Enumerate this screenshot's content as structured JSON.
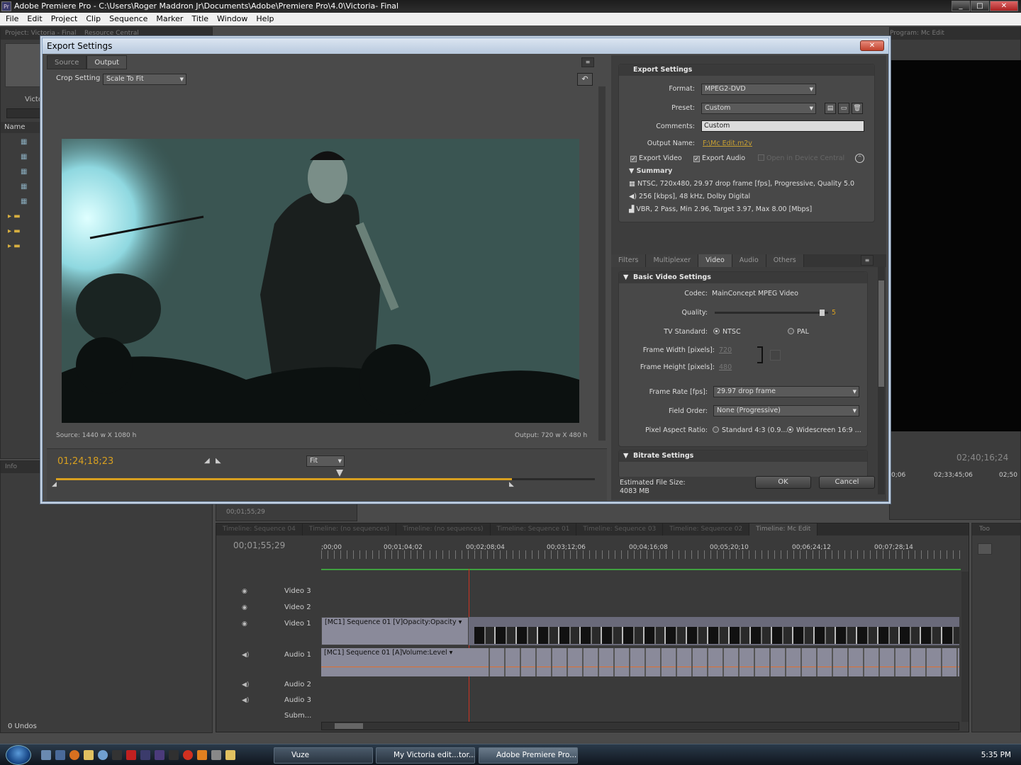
{
  "window": {
    "title": "Adobe Premiere Pro - C:\\Users\\Roger Maddron Jr\\Documents\\Adobe\\Premiere Pro\\4.0\\Victoria- Final",
    "icon": "Pr"
  },
  "menu": [
    "File",
    "Edit",
    "Project",
    "Clip",
    "Sequence",
    "Marker",
    "Title",
    "Window",
    "Help"
  ],
  "background": {
    "project_tab": "Project: Victoria - Final",
    "resource_tab": "Resource Central",
    "program_tab": "Program: Mc Edit",
    "project_bin": "Victo",
    "name_header": "Name",
    "info_tab": "Info",
    "undos": "0 Undos",
    "program_tc": "02;40;16;24",
    "program_ruler": [
      "0;06",
      "02;33;45;06",
      "02;50"
    ],
    "source_tc": "00;01;55;29"
  },
  "dialog": {
    "title": "Export Settings",
    "tabs": [
      "Source",
      "Output"
    ],
    "crop_label": "Crop Setting",
    "crop_value": "Scale To Fit",
    "source_info": "Source: 1440 w X 1080 h",
    "output_info": "Output: 720 w X 480 h",
    "timecode": "01;24;18;23",
    "fit": "Fit",
    "export_settings": {
      "header": "Export Settings",
      "format_label": "Format:",
      "format_value": "MPEG2-DVD",
      "preset_label": "Preset:",
      "preset_value": "Custom",
      "comments_label": "Comments:",
      "comments_value": "Custom",
      "output_label": "Output Name:",
      "output_value": "F:\\Mc Edit.m2v",
      "export_video": "Export Video",
      "export_audio": "Export Audio",
      "open_device": "Open in Device Central",
      "summary_label": "Summary",
      "summary": [
        "NTSC, 720x480, 29.97 drop frame [fps], Progressive, Quality 5.0",
        "256 [kbps], 48 kHz, Dolby Digital",
        "VBR, 2 Pass, Min 2.96, Target 3.97, Max 8.00 [Mbps]"
      ]
    },
    "settings_tabs": [
      "Filters",
      "Multiplexer",
      "Video",
      "Audio",
      "Others"
    ],
    "video": {
      "header": "Basic Video Settings",
      "codec_label": "Codec:",
      "codec_value": "MainConcept MPEG Video",
      "quality_label": "Quality:",
      "quality_value": "5",
      "quality_fraction": 0.97,
      "tv_label": "TV Standard:",
      "ntsc": "NTSC",
      "pal": "PAL",
      "fw_label": "Frame Width [pixels]:",
      "fw_value": "720",
      "fh_label": "Frame Height [pixels]:",
      "fh_value": "480",
      "fr_label": "Frame Rate [fps]:",
      "fr_value": "29.97 drop frame",
      "fo_label": "Field Order:",
      "fo_value": "None (Progressive)",
      "par_label": "Pixel Aspect Ratio:",
      "par_standard": "Standard 4:3 (0.9...",
      "par_wide": "Widescreen 16:9 ...",
      "bitrate_header": "Bitrate Settings"
    },
    "file_size_label": "Estimated File Size:",
    "file_size_value": "4083 MB",
    "ok": "OK",
    "cancel": "Cancel"
  },
  "timeline": {
    "tabs": [
      "Timeline: Sequence 04",
      "Timeline: (no sequences)",
      "Timeline: (no sequences)",
      "Timeline: Sequence 01",
      "Timeline: Sequence 03",
      "Timeline: Sequence 02",
      "Timeline: Mc Edit"
    ],
    "timecode": "00;01;55;29",
    "ruler": [
      ";00;00",
      "00;01;04;02",
      "00;02;08;04",
      "00;03;12;06",
      "00;04;16;08",
      "00;05;20;10",
      "00;06;24;12",
      "00;07;28;14"
    ],
    "tracks": [
      "Video 3",
      "Video 2",
      "Video 1",
      "Audio 1",
      "Audio 2",
      "Audio 3",
      "Subm..."
    ],
    "v1_clip": "[MC1] Sequence 01 [V]",
    "v1_fx": "Opacity:Opacity ▾",
    "a1_clip": "[MC1] Sequence 01 [A]",
    "a1_fx": "Volume:Level ▾",
    "tools_tab": "Too"
  },
  "taskbar": {
    "buttons": [
      "Vuze",
      "My Victoria edit...tor...",
      "Adobe Premiere Pro..."
    ],
    "clock": "5:35 PM"
  },
  "colors": {
    "accent_orange": "#d8a020",
    "dialog_frame": "#b8c9de",
    "playhead": "#cc3322"
  }
}
